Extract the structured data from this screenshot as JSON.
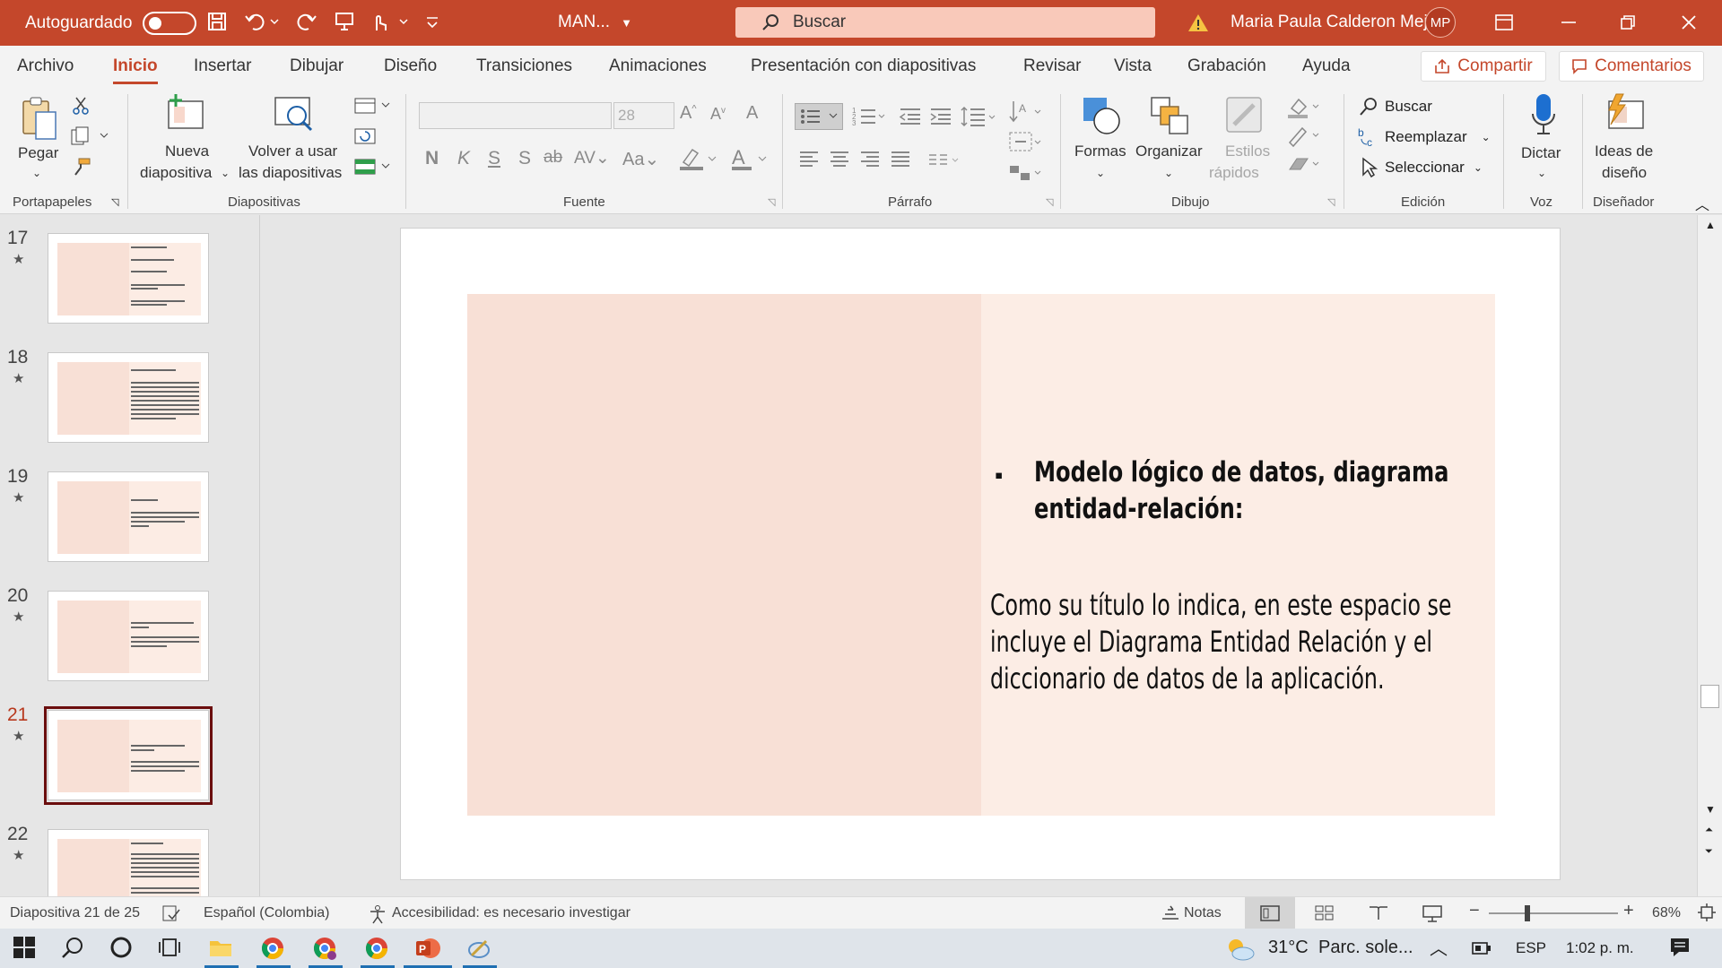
{
  "titlebar": {
    "autosave_label": "Autoguardado",
    "doc_name": "MAN...",
    "search_placeholder": "Buscar",
    "user_name": "Maria Paula Calderon Mejia",
    "user_initials": "MP",
    "accent": "#c4472b"
  },
  "menu": {
    "tabs": [
      "Archivo",
      "Inicio",
      "Insertar",
      "Dibujar",
      "Diseño",
      "Transiciones",
      "Animaciones",
      "Presentación con diapositivas",
      "Revisar",
      "Vista",
      "Grabación",
      "Ayuda"
    ],
    "active_tab": "Inicio",
    "share_label": "Compartir",
    "comments_label": "Comentarios"
  },
  "ribbon": {
    "paste_label": "Pegar",
    "new_slide_label_1": "Nueva",
    "new_slide_label_2": "diapositiva",
    "reuse_label_1": "Volver a usar",
    "reuse_label_2": "las diapositivas",
    "font_size": "28",
    "bold": "N",
    "italic": "K",
    "underline": "S",
    "shadow": "S",
    "strike": "ab",
    "case": "Aa",
    "shapes_label": "Formas",
    "arrange_label": "Organizar",
    "quick_styles_label_1": "Estilos",
    "quick_styles_label_2": "rápidos",
    "find_label": "Buscar",
    "replace_label": "Reemplazar",
    "select_label": "Seleccionar",
    "dictate_label": "Dictar",
    "design_ideas_label_1": "Ideas de",
    "design_ideas_label_2": "diseño",
    "groups": [
      "Portapapeles",
      "Diapositivas",
      "Fuente",
      "Párrafo",
      "Dibujo",
      "Edición",
      "Voz",
      "Diseñador"
    ]
  },
  "slides_pane": {
    "numbers": [
      "17",
      "18",
      "19",
      "20",
      "21",
      "22"
    ],
    "current": "21"
  },
  "slide": {
    "title": "Modelo lógico de datos, diagrama entidad-relación:",
    "body": "Como su título lo indica, en este espacio se incluye el Diagrama Entidad Relación y el diccionario de datos de la aplicación."
  },
  "status": {
    "slide_counter": "Diapositiva 21 de 25",
    "language": "Español (Colombia)",
    "accessibility": "Accesibilidad: es necesario investigar",
    "notes_label": "Notas",
    "zoom": "68%"
  },
  "taskbar": {
    "temperature": "31°C",
    "weather": "Parc. sole...",
    "lang": "ESP",
    "time": "1:02 p. m."
  }
}
